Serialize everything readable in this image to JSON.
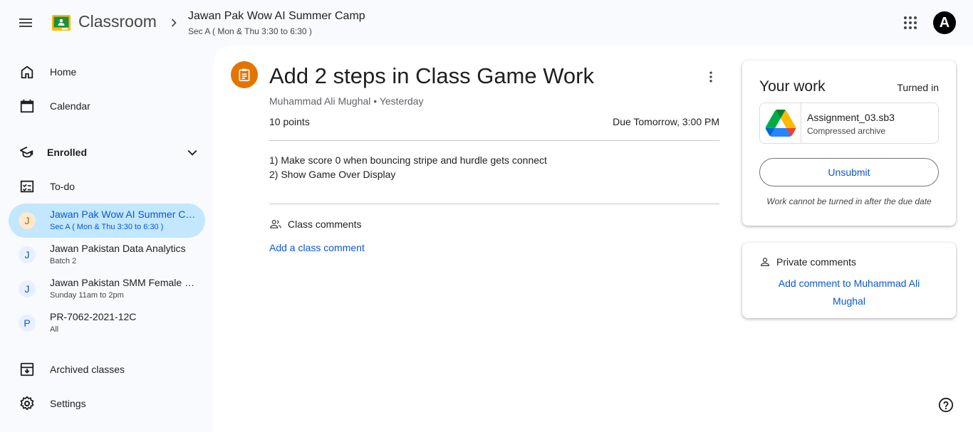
{
  "header": {
    "app_name": "Classroom",
    "class_title": "Jawan Pak Wow AI Summer Camp",
    "class_section": "Sec A ( Mon & Thu 3:30 to 6:30 )",
    "avatar_letter": "A"
  },
  "sidebar": {
    "home": "Home",
    "calendar": "Calendar",
    "enrolled": "Enrolled",
    "todo": "To-do",
    "classes": [
      {
        "initial": "J",
        "name": "Jawan Pak Wow AI Summer Camp",
        "sub": "Sec A ( Mon & Thu 3:30 to 6:30 )",
        "active": true
      },
      {
        "initial": "J",
        "name": "Jawan Pakistan Data Analytics",
        "sub": "Batch 2",
        "active": false
      },
      {
        "initial": "J",
        "name": "Jawan Pakistan SMM Female Batch",
        "sub": "Sunday 11am to 2pm",
        "active": false
      },
      {
        "initial": "P",
        "name": "PR-7062-2021-12C",
        "sub": "All",
        "active": false
      }
    ],
    "archived": "Archived classes",
    "settings": "Settings"
  },
  "assignment": {
    "title": "Add 2 steps in Class Game Work",
    "meta": "Muhammad Ali Mughal • Yesterday",
    "points": "10 points",
    "due": "Due Tomorrow, 3:00 PM",
    "instructions": [
      "1) Make score 0 when bouncing stripe and hurdle gets connect",
      "2) Show Game Over Display"
    ],
    "class_comments_label": "Class comments",
    "add_class_comment": "Add a class comment"
  },
  "your_work": {
    "title": "Your work",
    "status": "Turned in",
    "attachment": {
      "name": "Assignment_03.sb3",
      "type": "Compressed archive",
      "icon": "google-drive-icon"
    },
    "unsubmit_label": "Unsubmit",
    "note": "Work cannot be turned in after the due date"
  },
  "private_comments": {
    "label": "Private comments",
    "add_link": "Add comment to Muhammad Ali Mughal"
  },
  "colors": {
    "accent": "#0b57d0",
    "active_class_bg": "#c2e7ff",
    "assignment_icon_bg": "#e37400"
  }
}
